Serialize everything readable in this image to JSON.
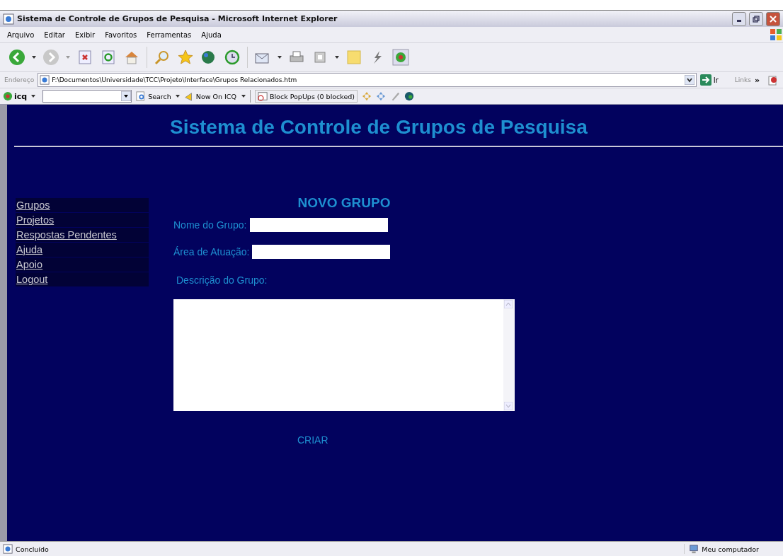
{
  "window": {
    "title": "Sistema de Controle de Grupos de Pesquisa - Microsoft Internet Explorer"
  },
  "menu": [
    "Arquivo",
    "Editar",
    "Exibir",
    "Favoritos",
    "Ferramentas",
    "Ajuda"
  ],
  "address_bar": {
    "label": "Endereço",
    "url": "F:\\Documentos\\Universidade\\TCC\\Projeto\\Interface\\Grupos Relacionados.htm",
    "go": "Ir",
    "links": "Links",
    "more": "»"
  },
  "icq_bar": {
    "brand": "icq",
    "search": "Search",
    "now_on": "Now On ICQ",
    "popups": "Block PopUps (0 blocked)"
  },
  "page": {
    "heading": "Sistema de Controle de Grupos de Pesquisa",
    "sidebar": [
      "Grupos",
      "Projetos",
      "Respostas Pendentes",
      "Ajuda",
      "Apoio",
      "Logout"
    ],
    "form_title": "NOVO GRUPO",
    "fields": [
      {
        "label": "Nome do Grupo:"
      },
      {
        "label": "Área de Atuação:"
      }
    ],
    "description_label": "Descrição do Grupo:",
    "submit": "CRIAR"
  },
  "status_bar": {
    "text": "Concluído",
    "zone": "Meu computador"
  }
}
